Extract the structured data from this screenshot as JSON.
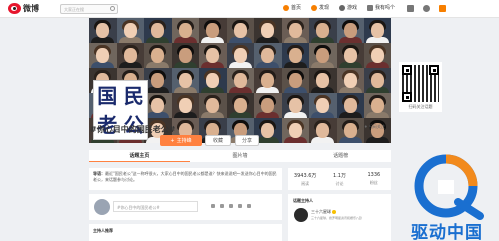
{
  "topbar": {
    "logo_text": "微博",
    "search_placeholder": "大家正在搜",
    "nav": [
      {
        "label": "首页",
        "icon": "home-icon"
      },
      {
        "label": "发现",
        "icon": "discover-icon"
      },
      {
        "label": "游戏",
        "icon": "game-icon"
      },
      {
        "label": "我有吗个",
        "icon": "user-icon"
      }
    ],
    "right_icons": [
      "mail-icon",
      "gear-icon",
      "compose-icon"
    ]
  },
  "banner": {
    "title_chars": [
      "国",
      "民",
      "老",
      "公"
    ],
    "topic_title": "#你心目中的国民老公#",
    "follow_label": "主持峰",
    "favorite_label": "收藏",
    "share_label": "分享",
    "qr_caption": "扫码关注话题",
    "report_label": "♦ 扫码关注"
  },
  "tabs": [
    "话题主页",
    "图片墙",
    "话题榜"
  ],
  "intro": {
    "label": "导语：",
    "text": "最近\"国民老公\"这一称呼很火，大家心目中的国民老公都是谁？快来说说吧～发送你心目中的国民老公，来话题参与讨论。"
  },
  "composer": {
    "placeholder": "#你心目中的国民老公#"
  },
  "feed": {
    "heading": "主持人推荐"
  },
  "stats": [
    {
      "value": "3943.6万",
      "label": "阅读"
    },
    {
      "value": "1.1万",
      "label": "讨论"
    },
    {
      "value": "1336",
      "label": "粉丝"
    }
  ],
  "host": {
    "title": "话题主持人",
    "name": "三十六星球",
    "desc": "三十六星球，搜罗明星资讯和娱乐八卦"
  },
  "watermark": {
    "text": "驱动中国"
  },
  "colors": {
    "accent": "#ff8140",
    "weibo_red": "#e6162d",
    "watermark_blue": "#1a6fd0",
    "watermark_orange": "#f28a1c"
  }
}
